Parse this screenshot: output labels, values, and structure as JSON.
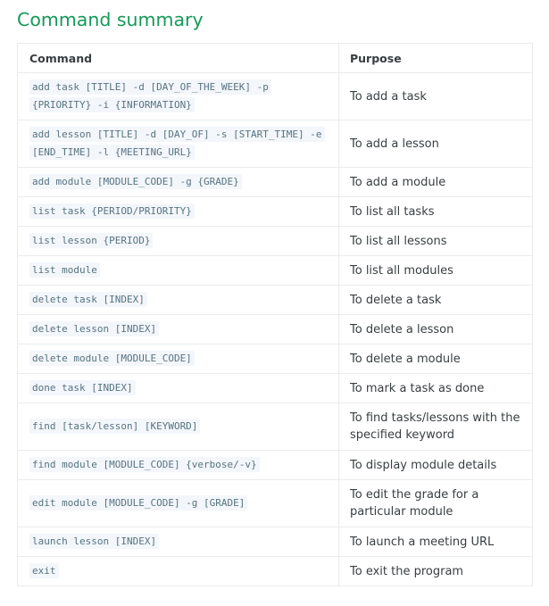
{
  "title": "Command summary",
  "table": {
    "headers": [
      "Command",
      "Purpose"
    ],
    "rows": [
      {
        "command": "add task [TITLE] -d [DAY_OF_THE_WEEK] -p {PRIORITY} -i {INFORMATION}",
        "purpose": "To add a task"
      },
      {
        "command": "add lesson [TITLE] -d [DAY_OF] -s [START_TIME] -e [END_TIME] -l {MEETING_URL}",
        "purpose": "To add a lesson"
      },
      {
        "command": "add module [MODULE_CODE] -g {GRADE}",
        "purpose": "To add a module"
      },
      {
        "command": "list task {PERIOD/PRIORITY}",
        "purpose": "To list all tasks"
      },
      {
        "command": "list lesson {PERIOD}",
        "purpose": "To list all lessons"
      },
      {
        "command": "list module",
        "purpose": "To list all modules"
      },
      {
        "command": "delete task [INDEX]",
        "purpose": "To delete a task"
      },
      {
        "command": "delete lesson [INDEX]",
        "purpose": "To delete a lesson"
      },
      {
        "command": "delete module [MODULE_CODE]",
        "purpose": "To delete a module"
      },
      {
        "command": "done task [INDEX]",
        "purpose": "To mark a task as done"
      },
      {
        "command": "find [task/lesson] [KEYWORD]",
        "purpose": "To find tasks/lessons with the specified keyword"
      },
      {
        "command": "find module [MODULE_CODE] {verbose/-v}",
        "purpose": "To display module details"
      },
      {
        "command": "edit module [MODULE_CODE] -g [GRADE]",
        "purpose": "To edit the grade for a particular module"
      },
      {
        "command": "launch lesson [INDEX]",
        "purpose": "To launch a meeting URL"
      },
      {
        "command": "exit",
        "purpose": "To exit the program"
      }
    ]
  }
}
